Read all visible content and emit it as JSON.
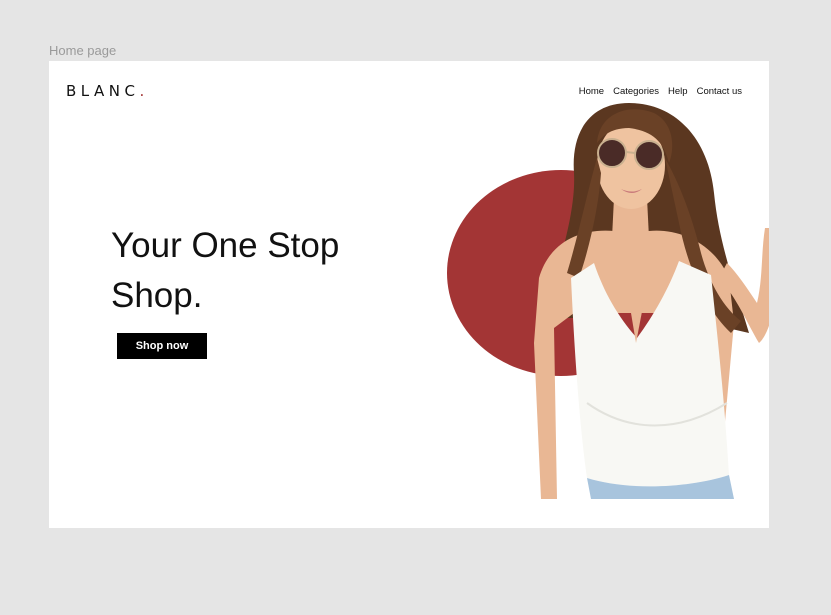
{
  "canvas": {
    "label": "Home page"
  },
  "brand": {
    "name": "BLANC",
    "dot": "."
  },
  "nav": {
    "items": [
      {
        "label": "Home"
      },
      {
        "label": "Categories"
      },
      {
        "label": "Help"
      },
      {
        "label": "Contact us"
      }
    ]
  },
  "hero": {
    "headline": "Your One Stop Shop.",
    "cta_label": "Shop now",
    "image": "model-photo"
  },
  "colors": {
    "accent": "#a33535",
    "background": "#ffffff",
    "canvas": "#e5e5e5",
    "button": "#000000"
  }
}
